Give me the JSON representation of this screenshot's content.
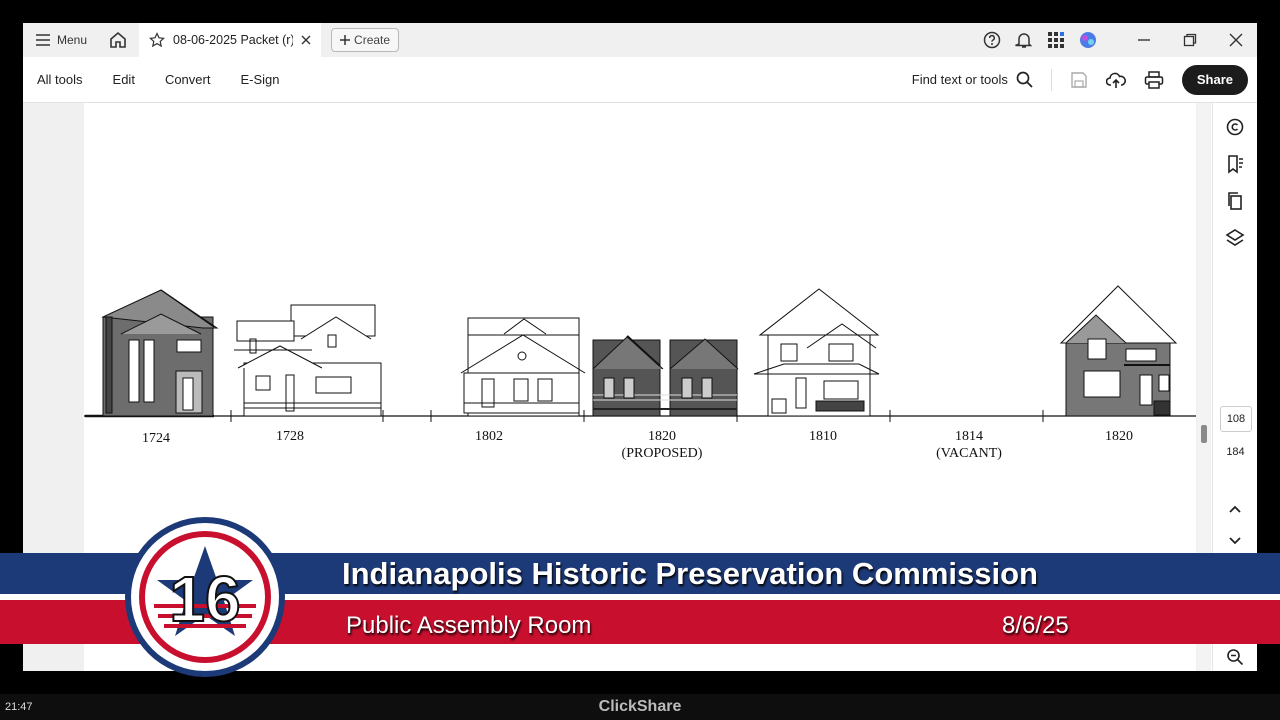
{
  "titlebar": {
    "menu_label": "Menu",
    "tab_title": "08-06-2025  Packet (r)...",
    "create_label": "Create"
  },
  "toolbar": {
    "items": [
      "All tools",
      "Edit",
      "Convert",
      "E-Sign"
    ],
    "find_label": "Find text or tools",
    "share_label": "Share"
  },
  "document": {
    "labels": [
      {
        "text": "1724",
        "sub": ""
      },
      {
        "text": "1728",
        "sub": ""
      },
      {
        "text": "1802",
        "sub": ""
      },
      {
        "text": "1820",
        "sub": "(PROPOSED)"
      },
      {
        "text": "1810",
        "sub": ""
      },
      {
        "text": "1814",
        "sub": "(VACANT)"
      },
      {
        "text": "1820",
        "sub": ""
      }
    ]
  },
  "page_nav": {
    "current_page": "108",
    "total_pages": "184"
  },
  "overlay": {
    "channel_number": "16",
    "title": "Indianapolis Historic Preservation Commission",
    "location": "Public Assembly Room",
    "date": "8/6/25",
    "clock": "21:47",
    "source": "ClickShare",
    "colors": {
      "blue": "#1d3a78",
      "red": "#c8102e"
    }
  }
}
